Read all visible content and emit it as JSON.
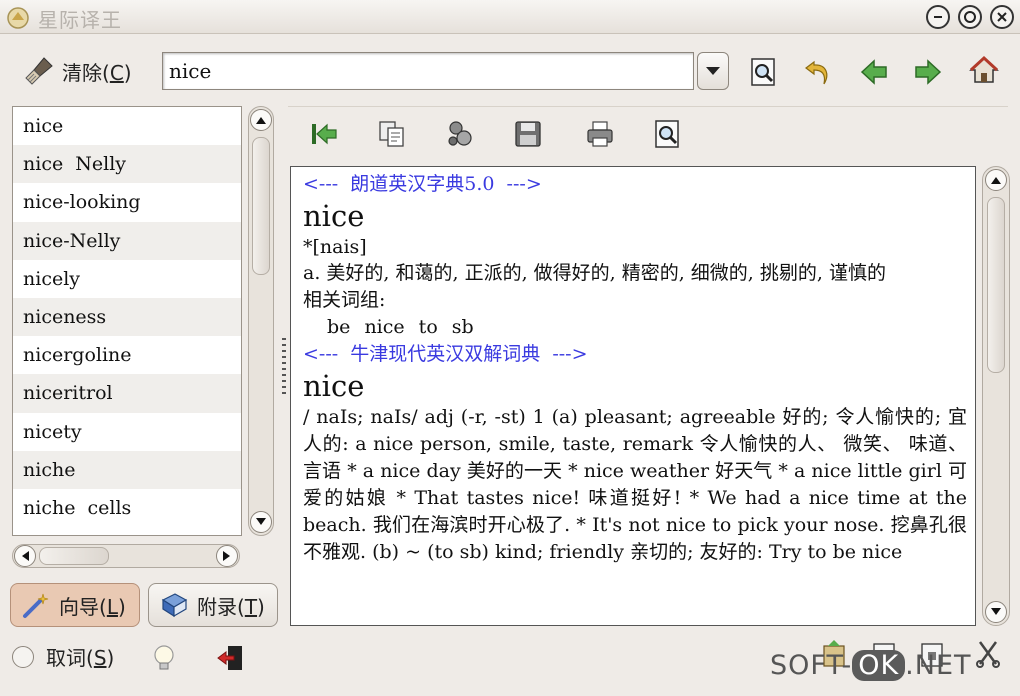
{
  "window": {
    "title": "星际译王",
    "controls": [
      "minimize",
      "maximize",
      "close"
    ]
  },
  "toolbar": {
    "clear_label_main": "清除(",
    "clear_label_key": "C",
    "clear_label_end": ")",
    "search_value": "nice",
    "icons": [
      "find-icon",
      "undo-icon",
      "back-arrow-icon",
      "forward-arrow-icon",
      "home-icon"
    ]
  },
  "word_list": {
    "items": [
      "nice",
      "nice  Nelly",
      "nice-looking",
      "nice-Nelly",
      "nicely",
      "niceness",
      "nicergoline",
      "niceritrol",
      "nicety",
      "niche",
      "niche  cells"
    ]
  },
  "left_tabs": {
    "guide_main": "向导(",
    "guide_key": "L",
    "guide_end": ")",
    "appendix_main": "附录(",
    "appendix_key": "T",
    "appendix_end": ")"
  },
  "bottom": {
    "scan_main": "取词(",
    "scan_key": "S",
    "scan_end": ")"
  },
  "content_toolbar": {
    "icons": [
      "jump-to-start-icon",
      "copy-icon",
      "pronounce-icon",
      "save-icon",
      "print-icon",
      "search-in-text-icon"
    ]
  },
  "definition": {
    "dict1_header": "<---  朗道英汉字典5.0  --->",
    "dict1_word": "nice",
    "dict1_pron": "*[nais]",
    "dict1_meaning": "a. 美好的, 和蔼的, 正派的, 做得好的, 精密的, 细微的, 挑剔的, 谨慎的",
    "dict1_related_label": "相关词组:",
    "dict1_related_phrase": "be nice to sb",
    "dict2_header": "<---  牛津现代英汉双解词典  --->",
    "dict2_word": "nice",
    "dict2_text": "/ naIs; naIs/ adj (-r, -st)  1 (a) pleasant; agreeable 好的; 令人愉快的; 宜人的: a nice person, smile, taste, remark 令人愉快的人、 微笑、 味道、 言语 * a nice day 美好的一天 * nice weather 好天气 * a nice little girl 可爱的姑娘 * That tastes nice! 味道挺好! * We had a nice time at the beach. 我们在海滨时开心极了. * It's not nice to pick your nose. 挖鼻孔很不雅观. (b) ~ (to sb) kind; friendly 亲切的; 友好的: Try to be nice"
  },
  "watermark": {
    "prefix": "SOFT-",
    "ok": "OK",
    "suffix": ".NET"
  },
  "colors": {
    "dict_header": "#3a3ae0",
    "active_tab": "#e9c9b3",
    "arrow_green": "#3f9a3a"
  }
}
